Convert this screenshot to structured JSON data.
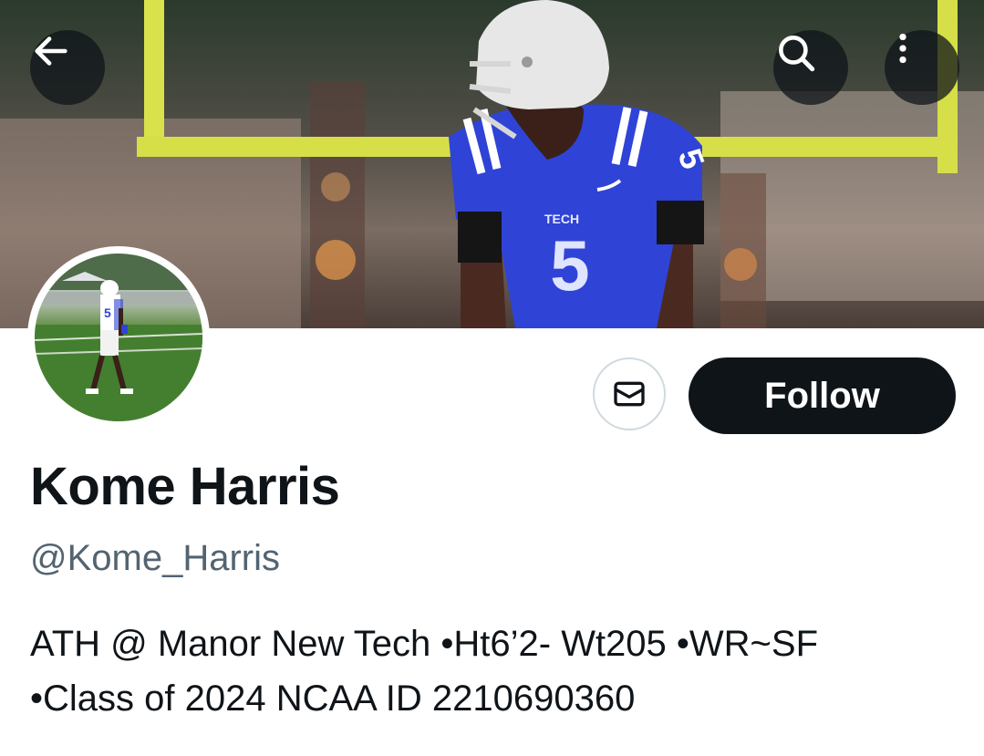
{
  "header": {
    "back_icon": "arrow-left-icon",
    "search_icon": "search-icon",
    "more_icon": "more-vertical-icon"
  },
  "banner": {
    "jersey_text": "TECH",
    "jersey_number": "5"
  },
  "profile": {
    "name": "Kome Harris",
    "handle": "@Kome_Harris",
    "bio_line1": "ATH @ Manor New Tech •Ht6’2- Wt205 •WR~SF",
    "bio_line2": "•Class of 2024 NCAA ID 2210690360"
  },
  "actions": {
    "message_icon": "envelope-icon",
    "follow_label": "Follow"
  },
  "colors": {
    "primary_text": "#0f1419",
    "secondary_text": "#536471",
    "follow_bg": "#0f1419",
    "border": "#cfd9de",
    "jersey_blue": "#2f43d6"
  }
}
